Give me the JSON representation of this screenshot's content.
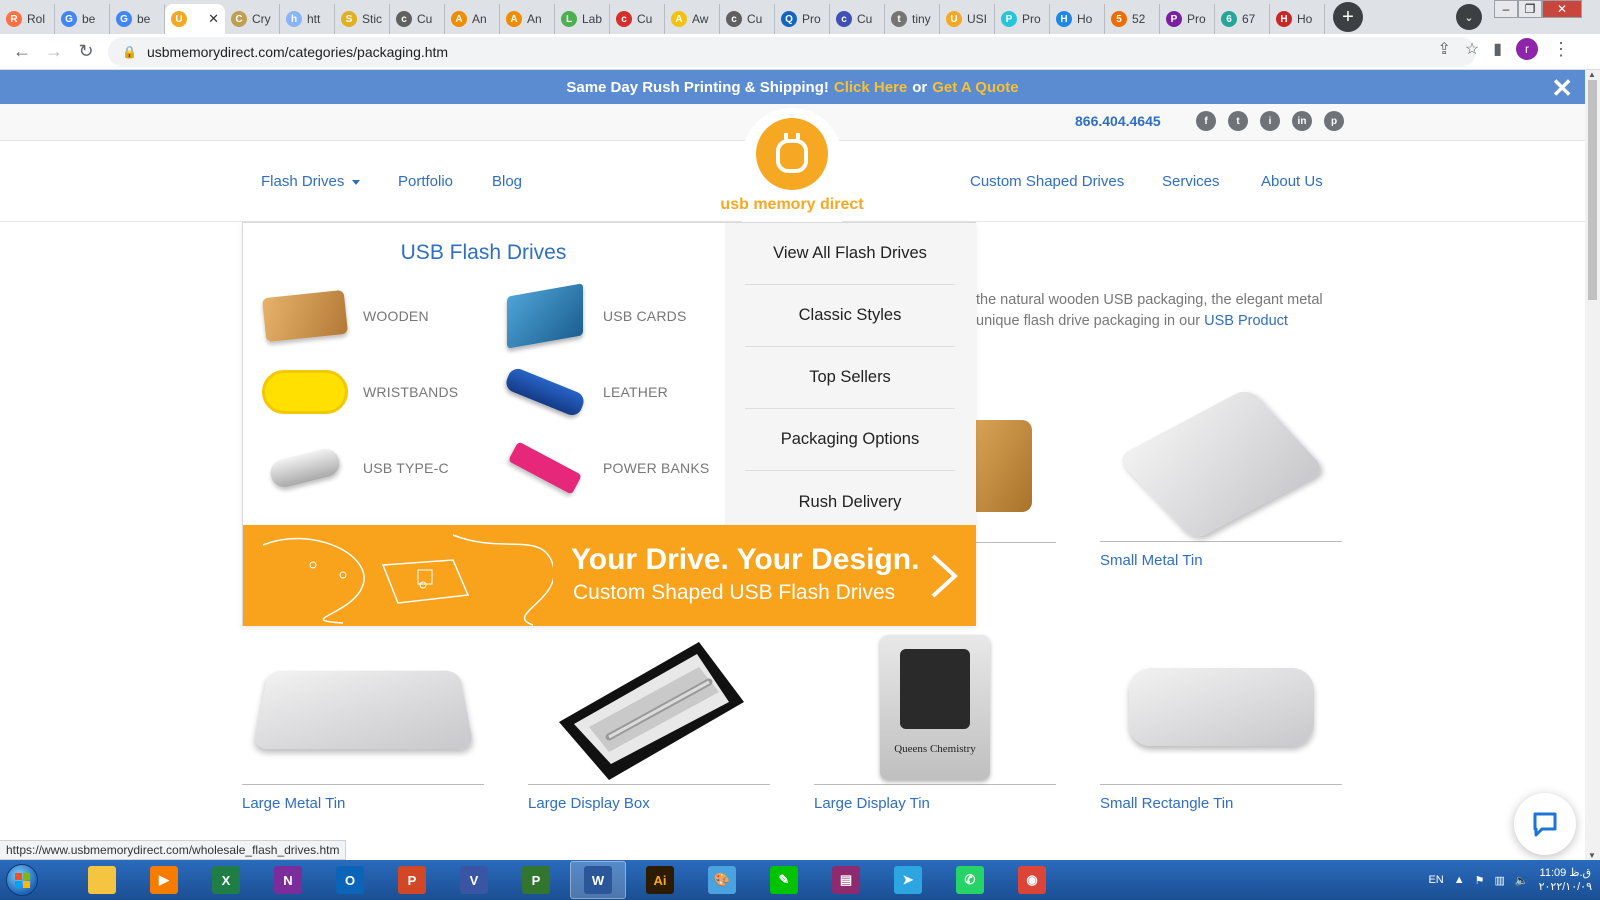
{
  "browser": {
    "tabs": [
      {
        "label": "Rol",
        "color": "#ff7043",
        "glyph": "R"
      },
      {
        "label": "be",
        "color": "#4285f4",
        "glyph": "G"
      },
      {
        "label": "be",
        "color": "#4285f4",
        "glyph": "G"
      },
      {
        "label": "",
        "color": "#f7a823",
        "glyph": "U",
        "active": true
      },
      {
        "label": "Cry",
        "color": "#c0a050",
        "glyph": "C"
      },
      {
        "label": "htt",
        "color": "#8ab4f8",
        "glyph": "h"
      },
      {
        "label": "Stic",
        "color": "#e0b020",
        "glyph": "S"
      },
      {
        "label": "Cu",
        "color": "#606060",
        "glyph": "c"
      },
      {
        "label": "An",
        "color": "#f08c00",
        "glyph": "A"
      },
      {
        "label": "An",
        "color": "#f08c00",
        "glyph": "A"
      },
      {
        "label": "Lab",
        "color": "#4caf50",
        "glyph": "L"
      },
      {
        "label": "Cu",
        "color": "#d32f2f",
        "glyph": "c"
      },
      {
        "label": "Aw",
        "color": "#f4c20d",
        "glyph": "A"
      },
      {
        "label": "Cu",
        "color": "#606060",
        "glyph": "c"
      },
      {
        "label": "Pro",
        "color": "#1565c0",
        "glyph": "Q"
      },
      {
        "label": "Cu",
        "color": "#3f51b5",
        "glyph": "c"
      },
      {
        "label": "tiny",
        "color": "#757575",
        "glyph": "t"
      },
      {
        "label": "USI",
        "color": "#f7a823",
        "glyph": "U"
      },
      {
        "label": "Pro",
        "color": "#26c6da",
        "glyph": "P"
      },
      {
        "label": "Ho",
        "color": "#1e88e5",
        "glyph": "H"
      },
      {
        "label": "52",
        "color": "#ef6c00",
        "glyph": "5"
      },
      {
        "label": "Pro",
        "color": "#7b1fa2",
        "glyph": "P"
      },
      {
        "label": "67",
        "color": "#26a69a",
        "glyph": "6"
      },
      {
        "label": "Ho",
        "color": "#c62828",
        "glyph": "H"
      }
    ],
    "new_tab": "+",
    "url": "usbmemorydirect.com/categories/packaging.htm",
    "profile_initial": "r",
    "status_url": "https://www.usbmemorydirect.com/wholesale_flash_drives.htm"
  },
  "banner": {
    "prefix": "Same Day Rush Printing & Shipping!",
    "link1": "Click Here",
    "middle": "or",
    "link2": "Get A Quote",
    "close": "✕"
  },
  "topbar": {
    "phone": "866.404.4645",
    "social": [
      "f",
      "t",
      "i",
      "in",
      "p"
    ]
  },
  "nav": {
    "left": [
      "Flash Drives",
      "Portfolio",
      "Blog"
    ],
    "right": [
      "Custom Shaped Drives",
      "Services",
      "About Us"
    ],
    "logo_text": "usb memory direct"
  },
  "mega": {
    "title": "USB Flash Drives",
    "categories": [
      "WOODEN",
      "USB CARDS",
      "WRISTBANDS",
      "LEATHER",
      "USB TYPE-C",
      "POWER BANKS"
    ],
    "links": [
      "View All Flash Drives",
      "Classic Styles",
      "Top Sellers",
      "Packaging Options",
      "Rush Delivery"
    ],
    "promo_title": "Your Drive. Your Design.",
    "promo_sub": "Custom Shaped USB Flash Drives"
  },
  "page": {
    "intro_line1": "the natural wooden USB packaging, the elegant metal",
    "intro_line2": "unique flash drive packaging in our",
    "intro_link": "USB Product",
    "products": [
      "Small Metal Tin",
      "Large Metal Tin",
      "Large Display Box",
      "Large Display Tin",
      "Small Rectangle Tin"
    ],
    "display_tin_text": "Queens Chemistry"
  },
  "taskbar": {
    "apps": [
      {
        "name": "file-explorer",
        "color": "#f5c542",
        "glyph": ""
      },
      {
        "name": "media-player",
        "color": "#f57c00",
        "glyph": "▶"
      },
      {
        "name": "excel",
        "color": "#1e7e45",
        "glyph": "X"
      },
      {
        "name": "onenote",
        "color": "#7b2d9b",
        "glyph": "N"
      },
      {
        "name": "outlook",
        "color": "#0a64b8",
        "glyph": "O"
      },
      {
        "name": "powerpoint",
        "color": "#d24726",
        "glyph": "P"
      },
      {
        "name": "visio",
        "color": "#3955a3",
        "glyph": "V"
      },
      {
        "name": "project",
        "color": "#31752f",
        "glyph": "P"
      },
      {
        "name": "word",
        "color": "#2b579a",
        "glyph": "W",
        "active": true
      },
      {
        "name": "illustrator",
        "color": "#2d1b00",
        "glyph": "Ai"
      },
      {
        "name": "paint",
        "color": "#4aa3df",
        "glyph": "🎨"
      },
      {
        "name": "line",
        "color": "#00c300",
        "glyph": "✎"
      },
      {
        "name": "winrar",
        "color": "#8e2a6e",
        "glyph": "▤"
      },
      {
        "name": "telegram",
        "color": "#2ca5e0",
        "glyph": "➤"
      },
      {
        "name": "whatsapp",
        "color": "#25d366",
        "glyph": "✆"
      },
      {
        "name": "chrome",
        "color": "#db4437",
        "glyph": "◉"
      }
    ],
    "lang": "EN",
    "time": "11:09 ق.ظ",
    "date": "۲۰۲۲/۱۰/۰۹"
  }
}
